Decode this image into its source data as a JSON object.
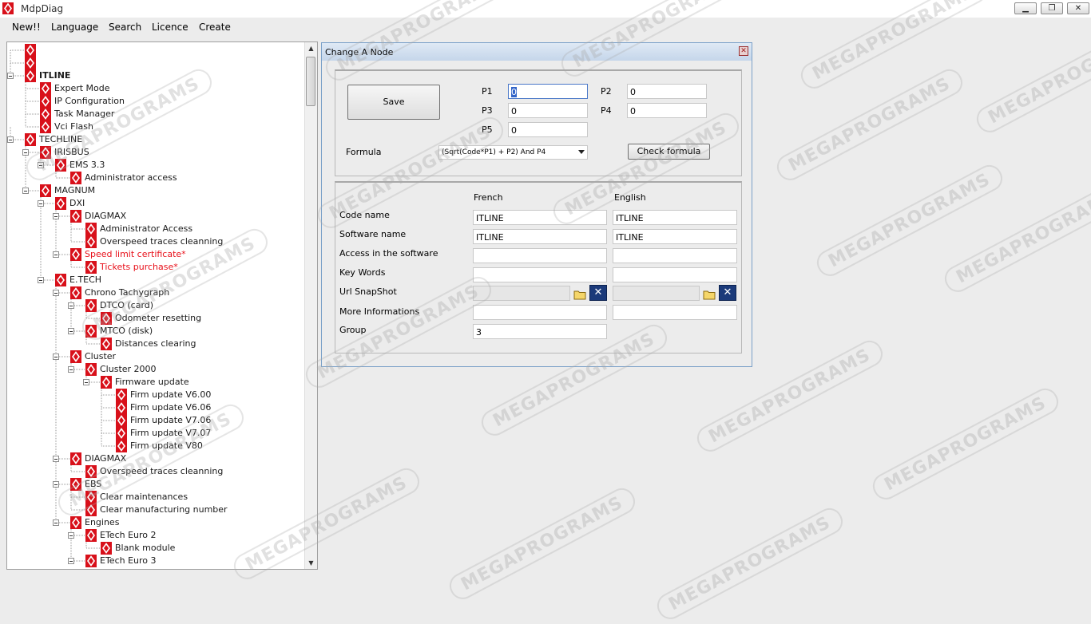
{
  "window": {
    "title": "MdpDiag",
    "controls": {
      "minimize": "▁",
      "maximize": "❐",
      "close": "✕"
    }
  },
  "menu": [
    "New!!",
    "Language",
    "Search",
    "Licence",
    "Create"
  ],
  "tree": {
    "nodes": [
      {
        "label": "",
        "depth": 0
      },
      {
        "label": "",
        "depth": 0
      },
      {
        "label": "ITLINE",
        "depth": 0,
        "bold": true,
        "expanded": true
      },
      {
        "label": "Expert Mode",
        "depth": 1
      },
      {
        "label": "IP Configuration",
        "depth": 1
      },
      {
        "label": "Task Manager",
        "depth": 1
      },
      {
        "label": "Vci Flash",
        "depth": 1
      },
      {
        "label": "TECHLINE",
        "depth": 0,
        "expanded": true
      },
      {
        "label": "IRISBUS",
        "depth": 1,
        "expanded": true
      },
      {
        "label": "EMS 3.3",
        "depth": 2,
        "expanded": true
      },
      {
        "label": "Administrator access",
        "depth": 3
      },
      {
        "label": "MAGNUM",
        "depth": 1,
        "expanded": true
      },
      {
        "label": "DXI",
        "depth": 2,
        "expanded": true
      },
      {
        "label": "DIAGMAX",
        "depth": 3,
        "expanded": true
      },
      {
        "label": "Administrator Access",
        "depth": 4
      },
      {
        "label": "Overspeed traces cleanning",
        "depth": 4
      },
      {
        "label": "Speed limit certificate*",
        "depth": 3,
        "red": true,
        "expanded": true
      },
      {
        "label": "Tickets purchase*",
        "depth": 4,
        "red": true
      },
      {
        "label": "E.TECH",
        "depth": 2,
        "expanded": true
      },
      {
        "label": "Chrono Tachygraph",
        "depth": 3,
        "expanded": true
      },
      {
        "label": "DTCO (card)",
        "depth": 4,
        "expanded": true
      },
      {
        "label": "Odometer resetting",
        "depth": 5
      },
      {
        "label": "MTCO (disk)",
        "depth": 4,
        "expanded": true
      },
      {
        "label": "Distances clearing",
        "depth": 5
      },
      {
        "label": "Cluster",
        "depth": 3,
        "expanded": true
      },
      {
        "label": "Cluster 2000",
        "depth": 4,
        "expanded": true
      },
      {
        "label": "Firmware update",
        "depth": 5,
        "expanded": true
      },
      {
        "label": "Firm update V6.00",
        "depth": 6
      },
      {
        "label": "Firm update V6.06",
        "depth": 6
      },
      {
        "label": "Firm update V7.06",
        "depth": 6
      },
      {
        "label": "Firm update V7.07",
        "depth": 6
      },
      {
        "label": "Firm update V80",
        "depth": 6
      },
      {
        "label": "DIAGMAX",
        "depth": 3,
        "expanded": true
      },
      {
        "label": "Overspeed traces cleanning",
        "depth": 4
      },
      {
        "label": "EBS",
        "depth": 3,
        "expanded": true
      },
      {
        "label": "Clear maintenances",
        "depth": 4
      },
      {
        "label": "Clear manufacturing number",
        "depth": 4
      },
      {
        "label": "Engines",
        "depth": 3,
        "expanded": true
      },
      {
        "label": "ETech Euro 2",
        "depth": 4,
        "expanded": true
      },
      {
        "label": "Blank module",
        "depth": 5
      },
      {
        "label": "ETech Euro 3",
        "depth": 4,
        "expanded": true
      }
    ],
    "scrollbar": {
      "up": "▲",
      "down": "▼"
    }
  },
  "dialog": {
    "title": "Change A Node",
    "close": "✕",
    "save_label": "Save",
    "params": {
      "p1_label": "P1",
      "p1_value": "0",
      "p2_label": "P2",
      "p2_value": "0",
      "p3_label": "P3",
      "p3_value": "0",
      "p4_label": "P4",
      "p4_value": "0",
      "p5_label": "P5",
      "p5_value": "0"
    },
    "formula_label": "Formula",
    "formula_value": "(Sqrt(Code*P1) + P2) And P4",
    "check_formula_label": "Check formula",
    "columns": {
      "french": "French",
      "english": "English"
    },
    "rows": {
      "code_name": {
        "label": "Code name",
        "fr": "ITLINE",
        "en": "ITLINE"
      },
      "software_name": {
        "label": "Software name",
        "fr": "ITLINE",
        "en": "ITLINE"
      },
      "access": {
        "label": "Access in the software",
        "fr": "",
        "en": ""
      },
      "keywords": {
        "label": "Key Words",
        "fr": "",
        "en": ""
      },
      "url_snapshot": {
        "label": "Url SnapShot",
        "fr": "",
        "en": ""
      },
      "more_info": {
        "label": "More Informations",
        "fr": "",
        "en": ""
      },
      "group": {
        "label": "Group",
        "value": "3"
      }
    },
    "clear_glyph": "✕"
  },
  "watermark_text": "MEGAPROGRAMS",
  "colors": {
    "accent_red": "#e8101a",
    "dialog_border": "#7aa0c8"
  }
}
